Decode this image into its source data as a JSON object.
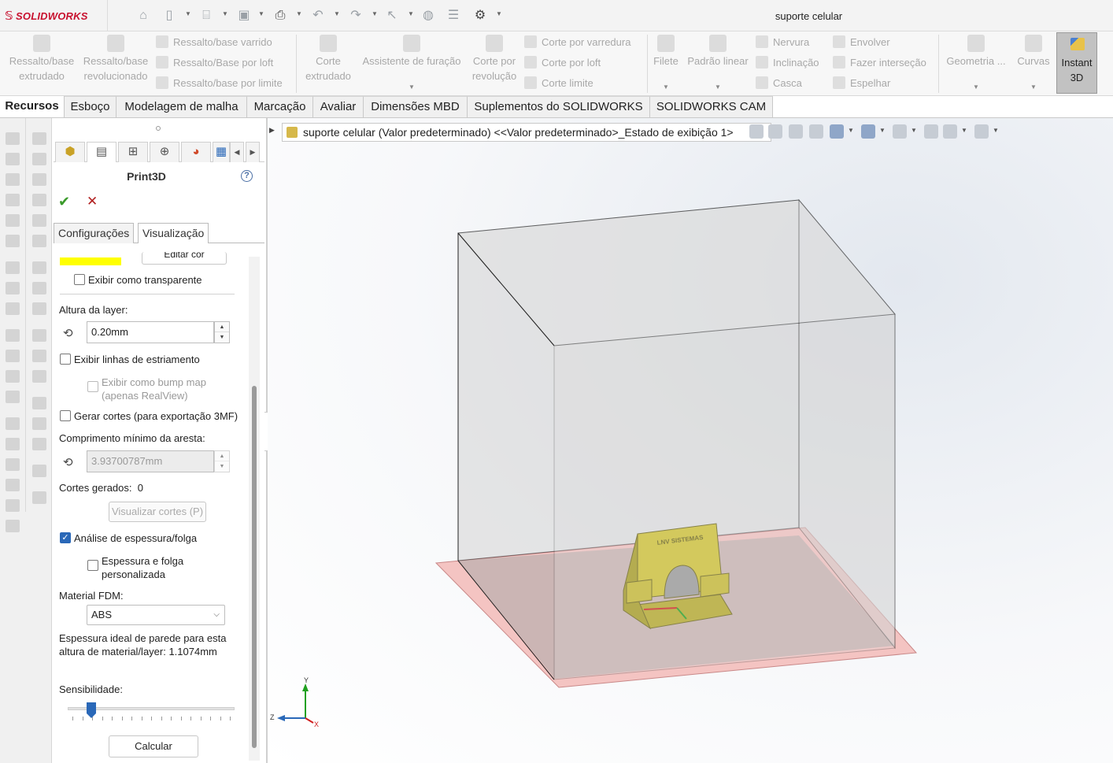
{
  "app": {
    "logo_text": "SOLIDWORKS",
    "document_title": "suporte celular"
  },
  "commands": {
    "extruded_boss": "Ressalto/base\nextrudado",
    "revolved_boss": "Ressalto/base\nrevolucionado",
    "swept_boss": "Ressalto/base varrido",
    "lofted_boss": "Ressalto/Base por loft",
    "boundary_boss": "Ressalto/base por limite",
    "extruded_cut": "Corte\nextrudado",
    "hole_wizard": "Assistente de furação",
    "revolved_cut": "Corte por\nrevolução",
    "swept_cut": "Corte por varredura",
    "lofted_cut": "Corte por loft",
    "boundary_cut": "Corte limite",
    "fillet": "Filete",
    "linear_pattern": "Padrão linear",
    "rib": "Nervura",
    "draft": "Inclinação",
    "shell": "Casca",
    "wrap": "Envolver",
    "intersect": "Fazer interseção",
    "mirror": "Espelhar",
    "ref_geometry": "Geometria ...",
    "curves": "Curvas",
    "instant3d": "Instant\n3D"
  },
  "tabs": [
    {
      "label": "Recursos",
      "active": true
    },
    {
      "label": "Esboço"
    },
    {
      "label": "Modelagem de malha"
    },
    {
      "label": "Marcação"
    },
    {
      "label": "Avaliar"
    },
    {
      "label": "Dimensões MBD"
    },
    {
      "label": "Suplementos do SOLIDWORKS"
    },
    {
      "label": "SOLIDWORKS CAM"
    }
  ],
  "pm": {
    "title": "Print3D",
    "subtab_config": "Configurações",
    "subtab_view": "Visualização",
    "edit_color_label": "Editar cor",
    "show_transparent": "Exibir como transparente",
    "layer_height_label": "Altura da layer:",
    "layer_height_value": "0.20mm",
    "show_striation": "Exibir linhas de estriamento",
    "bump_map": "Exibir como bump map\n(apenas RealView)",
    "gen_slices": "Gerar cortes (para exportação 3MF)",
    "min_edge_label": "Comprimento mínimo da aresta:",
    "min_edge_value": "3.93700787mm",
    "slices_generated_label": "Cortes gerados:",
    "slices_generated_value": "0",
    "view_slices_btn": "Visualizar cortes (P)",
    "thickness_analysis": "Análise de espessura/folga",
    "custom_thickness": "Espessura e folga\npersonalizada",
    "fdm_material_label": "Material FDM:",
    "fdm_material_value": "ABS",
    "ideal_wall": "Espessura ideal de parede para esta\naltura de material/layer: 1.1074mm",
    "sensitivity_label": "Sensibilidade:",
    "sensitivity_level": 0.12,
    "calculate_btn": "Calcular",
    "preview_color": "#ffff00"
  },
  "graphics": {
    "tree_text": "suporte celular (Valor predeterminado) <<Valor predeterminado>_Estado de exibição 1>",
    "part_label": "LNV SISTEMAS",
    "triad_y": "Y",
    "triad_z": "Z",
    "triad_x": "X"
  },
  "colors": {
    "brand_red": "#c8102e",
    "accent_blue": "#2a68b8",
    "part_yellow": "#d1c433",
    "build_plate": "#f4c4c2"
  }
}
